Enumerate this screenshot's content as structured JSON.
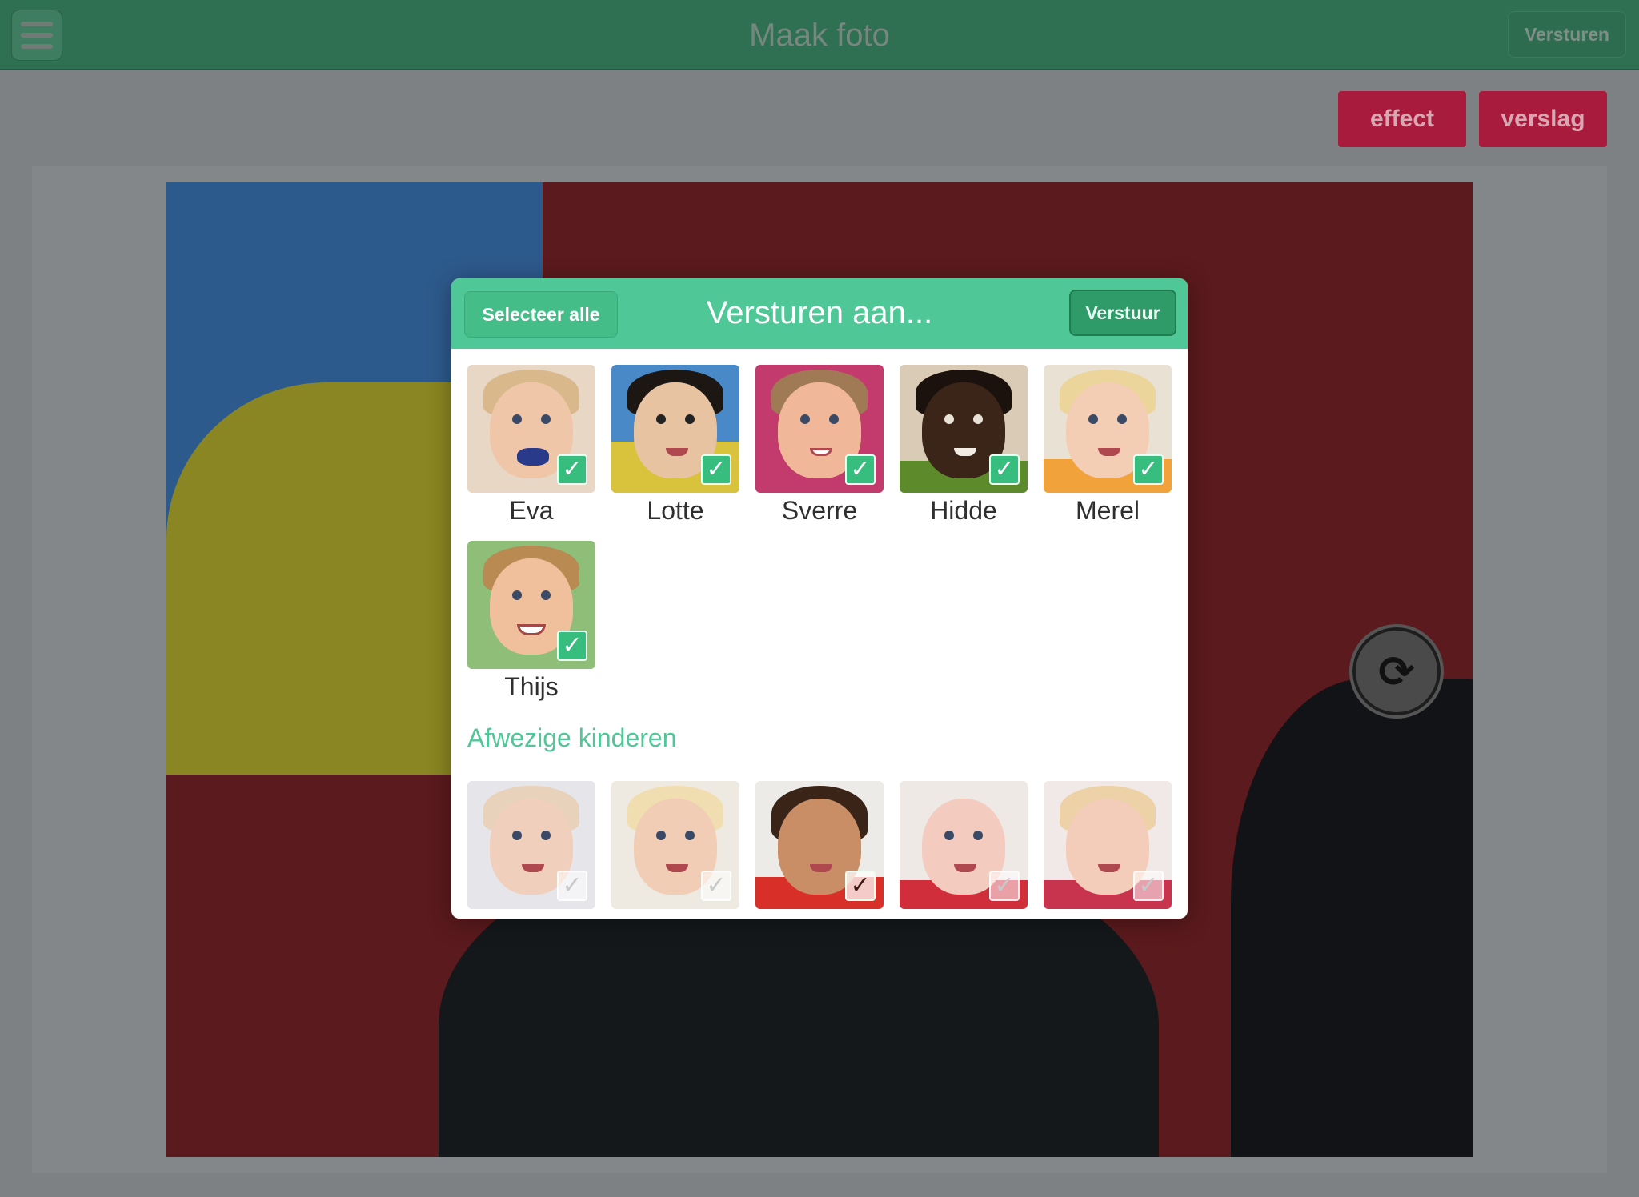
{
  "header": {
    "title": "Maak foto",
    "send_label": "Versturen"
  },
  "actions": {
    "effect_label": "effect",
    "verslag_label": "verslag"
  },
  "modal": {
    "title": "Versturen aan...",
    "select_all_label": "Selecteer alle",
    "submit_label": "Verstuur",
    "present_children": [
      {
        "name": "Eva",
        "checked": true
      },
      {
        "name": "Lotte",
        "checked": true
      },
      {
        "name": "Sverre",
        "checked": true
      },
      {
        "name": "Hidde",
        "checked": true
      },
      {
        "name": "Merel",
        "checked": true
      },
      {
        "name": "Thijs",
        "checked": true
      }
    ],
    "absent_section_title": "Afwezige kinderen",
    "absent_children": [
      {
        "checked": false
      },
      {
        "checked": false
      },
      {
        "checked": false
      },
      {
        "checked": false
      },
      {
        "checked": false
      }
    ]
  },
  "colors": {
    "header_bg": "#2f7052",
    "modal_header": "#4fc796",
    "action_button": "#a81b3c",
    "check_on": "#37be7e"
  },
  "icons": {
    "menu": "hamburger-icon",
    "rotate": "rotate-icon",
    "check": "checkmark-icon"
  }
}
